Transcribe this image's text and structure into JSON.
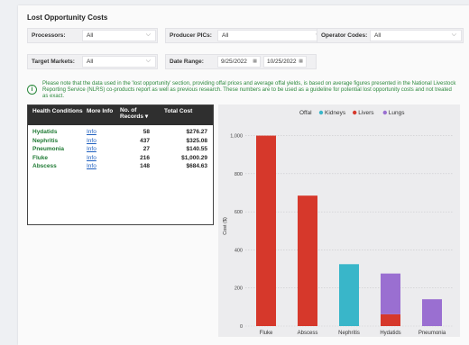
{
  "title": "Lost Opportunity Costs",
  "filters": {
    "processors": {
      "label": "Processors:",
      "value": "All"
    },
    "producer_pics": {
      "label": "Producer PICs:",
      "value": "All"
    },
    "operator_codes": {
      "label": "Operator Codes:",
      "value": "All"
    },
    "target_markets": {
      "label": "Target Markets:",
      "value": "All"
    },
    "date_range": {
      "label": "Date Range:",
      "from": "9/25/2022",
      "to": "10/25/2022"
    }
  },
  "notice": "Please note that the data used in the 'lost opportunity' section, providing offal prices and average offal yields, is based on average figures presented in the National Livestock Reporting Service (NLRS) co-products report as well as previous research. These numbers are to be used as a guideline for potential lost opportunity costs and not treated as exact.",
  "table": {
    "headers": [
      "Health Conditions",
      "More Info",
      "No. of Records",
      "Total Cost"
    ],
    "sort_indicator": "▾",
    "rows": [
      {
        "condition": "Hydatids",
        "info": "Info",
        "records": "58",
        "cost": "$276.27"
      },
      {
        "condition": "Nephritis",
        "info": "Info",
        "records": "437",
        "cost": "$325.08"
      },
      {
        "condition": "Pneumonia",
        "info": "Info",
        "records": "27",
        "cost": "$140.55"
      },
      {
        "condition": "Fluke",
        "info": "Info",
        "records": "216",
        "cost": "$1,000.29"
      },
      {
        "condition": "Abscess",
        "info": "Info",
        "records": "148",
        "cost": "$684.63"
      }
    ]
  },
  "chart_data": {
    "type": "bar",
    "stacked": true,
    "legend_title": "Offal",
    "legend_position": "top-center",
    "categories": [
      "Fluke",
      "Abscess",
      "Nephritis",
      "Hydatids",
      "Pneumonia"
    ],
    "series": [
      {
        "name": "Kidneys",
        "color": "#39b6c9",
        "values": [
          0,
          0,
          325,
          0,
          0
        ]
      },
      {
        "name": "Livers",
        "color": "#d6382b",
        "values": [
          1000,
          685,
          0,
          62,
          0
        ]
      },
      {
        "name": "Lungs",
        "color": "#9a6fd1",
        "values": [
          0,
          0,
          0,
          214,
          141
        ]
      }
    ],
    "ylabel": "Cost ($)",
    "ylim": [
      0,
      1050
    ],
    "yticks": [
      0,
      200,
      400,
      600,
      800,
      1000
    ],
    "ytick_labels": [
      "0",
      "200",
      "400",
      "600",
      "800",
      "1,000"
    ],
    "grid": true
  }
}
